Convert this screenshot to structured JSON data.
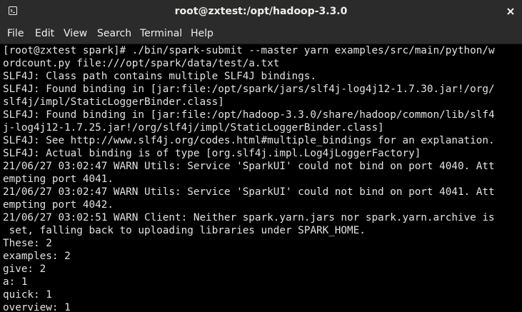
{
  "window": {
    "title": "root@zxtest:/opt/hadoop-3.3.0"
  },
  "icons": {
    "terminal": "terminal-icon",
    "close": "close-icon"
  },
  "menu": [
    {
      "label": "File"
    },
    {
      "label": "Edit"
    },
    {
      "label": "View"
    },
    {
      "label": "Search"
    },
    {
      "label": "Terminal"
    },
    {
      "label": "Help"
    }
  ],
  "terminal": {
    "lines": [
      "[root@zxtest spark]# ./bin/spark-submit --master yarn examples/src/main/python/w",
      "ordcount.py file:///opt/spark/data/test/a.txt",
      "SLF4J: Class path contains multiple SLF4J bindings.",
      "SLF4J: Found binding in [jar:file:/opt/spark/jars/slf4j-log4j12-1.7.30.jar!/org/",
      "slf4j/impl/StaticLoggerBinder.class]",
      "SLF4J: Found binding in [jar:file:/opt/hadoop-3.3.0/share/hadoop/common/lib/slf4",
      "j-log4j12-1.7.25.jar!/org/slf4j/impl/StaticLoggerBinder.class]",
      "SLF4J: See http://www.slf4j.org/codes.html#multiple_bindings for an explanation.",
      "SLF4J: Actual binding is of type [org.slf4j.impl.Log4jLoggerFactory]",
      "21/06/27 03:02:47 WARN Utils: Service 'SparkUI' could not bind on port 4040. Att",
      "empting port 4041.",
      "21/06/27 03:02:47 WARN Utils: Service 'SparkUI' could not bind on port 4041. Att",
      "empting port 4042.",
      "21/06/27 03:02:51 WARN Client: Neither spark.yarn.jars nor spark.yarn.archive is",
      " set, falling back to uploading libraries under SPARK_HOME.",
      "These: 2",
      "examples: 2",
      "give: 2",
      "a: 1",
      "quick: 1",
      "overview: 1"
    ]
  },
  "colors": {
    "titlebar_bg": "#2b2b2b",
    "terminal_bg": "#000000",
    "terminal_fg": "#e2e2e2",
    "ui_text": "#eeeeec"
  }
}
